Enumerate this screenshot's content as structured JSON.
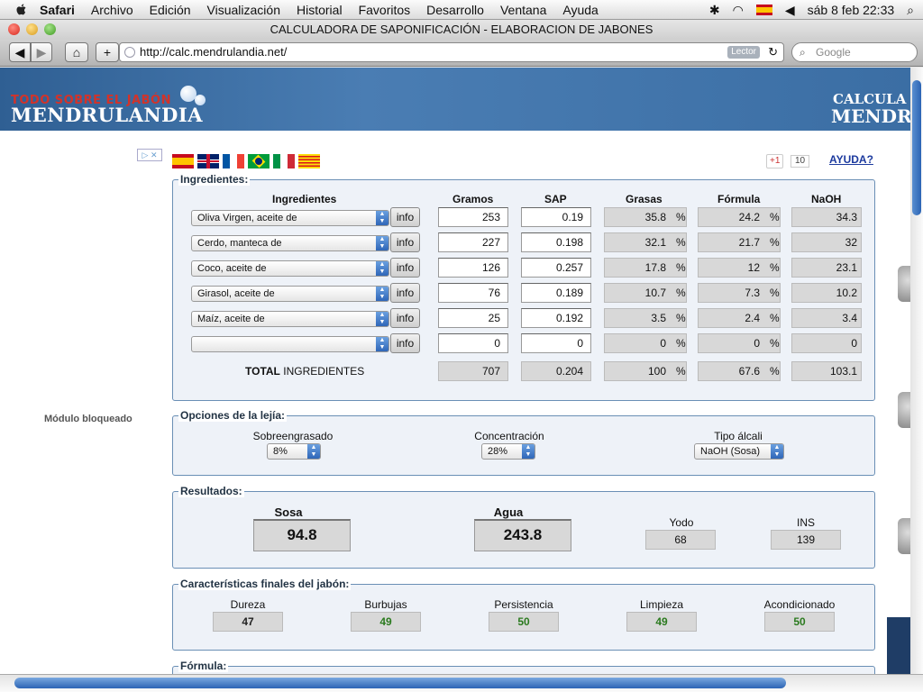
{
  "menubar": {
    "app": "Safari",
    "items": [
      "Archivo",
      "Edición",
      "Visualización",
      "Historial",
      "Favoritos",
      "Desarrollo",
      "Ventana",
      "Ayuda"
    ],
    "clock": "sáb 8 feb  22:33"
  },
  "window": {
    "title": "CALCULADORA DE SAPONIFICACIÓN - ELABORACION DE JABONES"
  },
  "toolbar": {
    "url": "http://calc.mendrulandia.net/",
    "reader_label": "Lector",
    "search_placeholder": "Google"
  },
  "banner": {
    "tagline": "TODO SOBRE EL JABÓN",
    "brand": "MENDRULANDIA",
    "right_top": "CALCULA",
    "right_bottom": "MENDR"
  },
  "sidebar": {
    "blocked_label": "Módulo bloqueado"
  },
  "top": {
    "gplus_label": "+1",
    "gplus_count": "10",
    "help_link": "AYUDA?"
  },
  "ingredients": {
    "legend": "Ingredientes:",
    "headers": {
      "ingredient": "Ingredientes",
      "grams": "Gramos",
      "sap": "SAP",
      "fats": "Grasas",
      "formula": "Fórmula",
      "naoh": "NaOH"
    },
    "info_label": "info",
    "pct_sign": "%",
    "rows": [
      {
        "name": "Oliva Virgen, aceite de",
        "grams": "253",
        "sap": "0.19",
        "fats": "35.8",
        "formula": "24.2",
        "naoh": "34.3"
      },
      {
        "name": "Cerdo, manteca de",
        "grams": "227",
        "sap": "0.198",
        "fats": "32.1",
        "formula": "21.7",
        "naoh": "32"
      },
      {
        "name": "Coco, aceite de",
        "grams": "126",
        "sap": "0.257",
        "fats": "17.8",
        "formula": "12",
        "naoh": "23.1"
      },
      {
        "name": "Girasol, aceite de",
        "grams": "76",
        "sap": "0.189",
        "fats": "10.7",
        "formula": "7.3",
        "naoh": "10.2"
      },
      {
        "name": "Maíz, aceite de",
        "grams": "25",
        "sap": "0.192",
        "fats": "3.5",
        "formula": "2.4",
        "naoh": "3.4"
      },
      {
        "name": "",
        "grams": "0",
        "sap": "0",
        "fats": "0",
        "formula": "0",
        "naoh": "0"
      }
    ],
    "total": {
      "label_bold": "TOTAL",
      "label_rest": "INGREDIENTES",
      "grams": "707",
      "sap": "0.204",
      "fats": "100",
      "formula": "67.6",
      "naoh": "103.1"
    }
  },
  "lye": {
    "legend": "Opciones de la lejía:",
    "superfat_label": "Sobreengrasado",
    "superfat_value": "8%",
    "concentration_label": "Concentración",
    "concentration_value": "28%",
    "alkali_label": "Tipo álcali",
    "alkali_value": "NaOH (Sosa)"
  },
  "results": {
    "legend": "Resultados:",
    "sosa_label": "Sosa",
    "sosa_value": "94.8",
    "agua_label": "Agua",
    "agua_value": "243.8",
    "yodo_label": "Yodo",
    "yodo_value": "68",
    "ins_label": "INS",
    "ins_value": "139"
  },
  "features": {
    "legend": "Características finales del jabón:",
    "items": [
      {
        "label": "Dureza",
        "value": "47",
        "color": "#222222"
      },
      {
        "label": "Burbujas",
        "value": "49",
        "color": "#2a7a1e"
      },
      {
        "label": "Persistencia",
        "value": "50",
        "color": "#2a7a1e"
      },
      {
        "label": "Limpieza",
        "value": "49",
        "color": "#2a7a1e"
      },
      {
        "label": "Acondicionado",
        "value": "50",
        "color": "#2a7a1e"
      }
    ]
  },
  "formula_section": {
    "legend": "Fórmula:"
  },
  "colors": {
    "accent": "#2f66b8",
    "banner_red": "#d2332a",
    "banner_blue": "#3b6ea4"
  }
}
